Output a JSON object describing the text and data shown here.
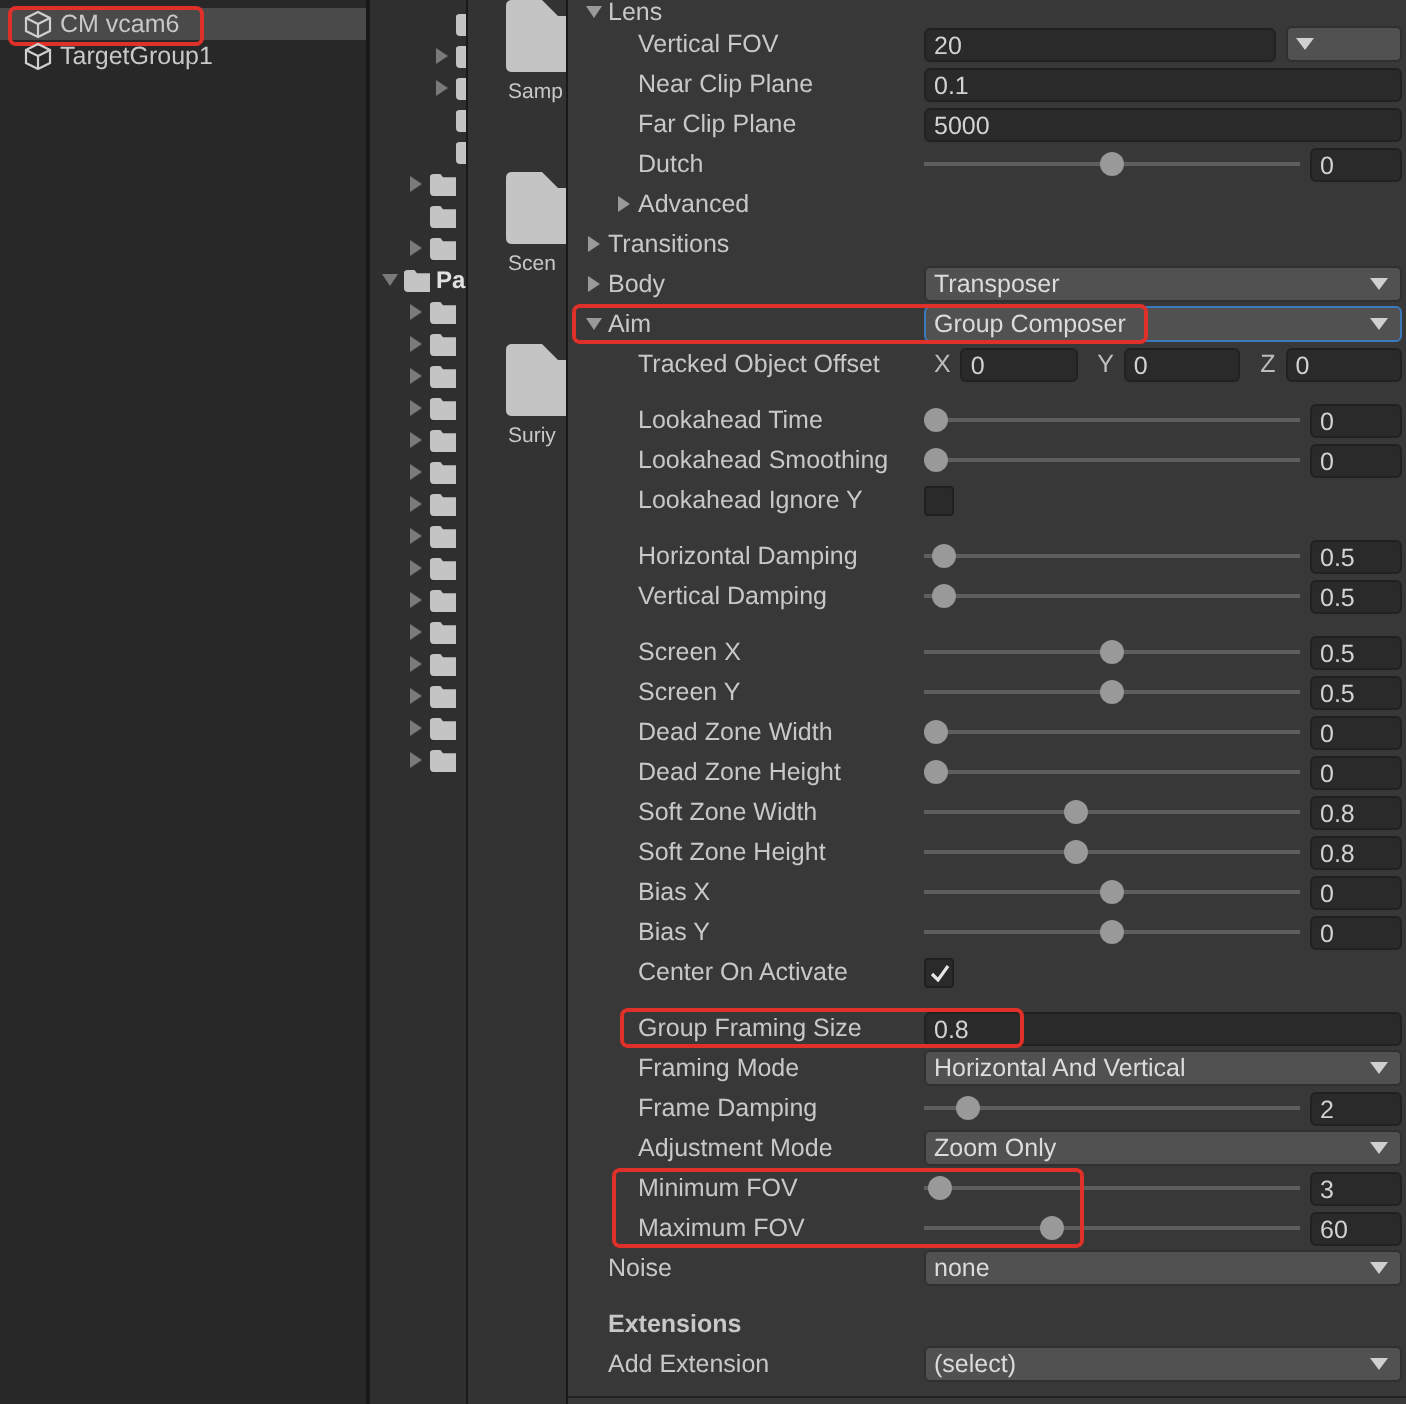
{
  "hierarchy": {
    "items": [
      {
        "label": "CM vcam6",
        "selected": true,
        "highlighted": true
      },
      {
        "label": "TargetGroup1",
        "selected": false,
        "highlighted": false
      }
    ]
  },
  "project_tree": {
    "top_items": [
      {
        "arrow": false
      },
      {
        "arrow": true,
        "expanded": false
      },
      {
        "arrow": true,
        "expanded": false
      },
      {
        "arrow": false
      },
      {
        "arrow": false
      }
    ],
    "upper_items": [
      {
        "arrow": true,
        "expanded": false
      },
      {
        "arrow": false
      },
      {
        "arrow": true,
        "expanded": false
      }
    ],
    "items": [
      {
        "arrow": true,
        "expanded": true,
        "label": "Pa",
        "children": [
          {
            "arrow": true,
            "expanded": false
          },
          {
            "arrow": true,
            "expanded": false
          },
          {
            "arrow": true,
            "expanded": false
          },
          {
            "arrow": true,
            "expanded": false
          },
          {
            "arrow": true,
            "expanded": false
          },
          {
            "arrow": true,
            "expanded": false
          },
          {
            "arrow": true,
            "expanded": false
          },
          {
            "arrow": true,
            "expanded": false
          },
          {
            "arrow": true,
            "expanded": false
          },
          {
            "arrow": true,
            "expanded": false
          },
          {
            "arrow": true,
            "expanded": false
          },
          {
            "arrow": true,
            "expanded": false
          },
          {
            "arrow": true,
            "expanded": false
          },
          {
            "arrow": true,
            "expanded": false
          },
          {
            "arrow": true,
            "expanded": false
          }
        ]
      }
    ]
  },
  "project_grid": {
    "items": [
      {
        "label": "Samp"
      },
      {
        "label": "Scen"
      },
      {
        "label": "Suriy"
      }
    ]
  },
  "inspector": {
    "sections": [
      {
        "kind": "foldout",
        "label": "Lens",
        "expanded": true,
        "children": [
          {
            "kind": "float_dropdown",
            "label": "Vertical FOV",
            "value": "20"
          },
          {
            "kind": "float",
            "label": "Near Clip Plane",
            "value": "0.1"
          },
          {
            "kind": "float",
            "label": "Far Clip Plane",
            "value": "5000"
          },
          {
            "kind": "slider",
            "label": "Dutch",
            "level": 0.5,
            "value": "0"
          },
          {
            "kind": "foldout",
            "label": "Advanced",
            "expanded": false
          }
        ]
      },
      {
        "kind": "foldout",
        "label": "Transitions",
        "expanded": false
      },
      {
        "kind": "foldout_dropdown",
        "label": "Body",
        "expanded": false,
        "value": "Transposer",
        "focused": false,
        "highlighted": false
      },
      {
        "kind": "foldout_dropdown",
        "label": "Aim",
        "expanded": true,
        "value": "Group Composer",
        "focused": true,
        "highlighted": true,
        "groups": [
          {
            "children": [
              {
                "kind": "vector",
                "label": "Tracked Object Offset",
                "components": [
                  {
                    "axis": "X",
                    "value": "0"
                  },
                  {
                    "axis": "Y",
                    "value": "0"
                  },
                  {
                    "axis": "Z",
                    "value": "0"
                  }
                ]
              }
            ]
          },
          {
            "children": [
              {
                "kind": "slider",
                "label": "Lookahead Time",
                "level": 0,
                "value": "0"
              },
              {
                "kind": "slider",
                "label": "Lookahead Smoothing",
                "level": 0,
                "value": "0"
              },
              {
                "kind": "checkbox",
                "label": "Lookahead Ignore Y",
                "checked": false
              }
            ]
          },
          {
            "children": [
              {
                "kind": "slider",
                "label": "Horizontal Damping",
                "level": 0.02,
                "value": "0.5"
              },
              {
                "kind": "slider",
                "label": "Vertical Damping",
                "level": 0.02,
                "value": "0.5"
              }
            ]
          },
          {
            "children": [
              {
                "kind": "slider",
                "label": "Screen X",
                "level": 0.5,
                "value": "0.5"
              },
              {
                "kind": "slider",
                "label": "Screen Y",
                "level": 0.5,
                "value": "0.5"
              },
              {
                "kind": "slider",
                "label": "Dead Zone Width",
                "level": 0,
                "value": "0"
              },
              {
                "kind": "slider",
                "label": "Dead Zone Height",
                "level": 0,
                "value": "0"
              },
              {
                "kind": "slider",
                "label": "Soft Zone Width",
                "level": 0.4,
                "value": "0.8"
              },
              {
                "kind": "slider",
                "label": "Soft Zone Height",
                "level": 0.4,
                "value": "0.8"
              },
              {
                "kind": "slider",
                "label": "Bias X",
                "level": 0.5,
                "value": "0"
              },
              {
                "kind": "slider",
                "label": "Bias Y",
                "level": 0.5,
                "value": "0"
              },
              {
                "kind": "checkbox",
                "label": "Center On Activate",
                "checked": true
              }
            ]
          },
          {
            "children": [
              {
                "kind": "float",
                "label": "Group Framing Size",
                "value": "0.8",
                "highlighted": true
              },
              {
                "kind": "dropdown",
                "label": "Framing Mode",
                "value": "Horizontal And Vertical"
              },
              {
                "kind": "slider",
                "label": "Frame Damping",
                "level": 0.09,
                "value": "2"
              },
              {
                "kind": "dropdown",
                "label": "Adjustment Mode",
                "value": "Zoom Only"
              },
              {
                "kind": "highlight_group",
                "children": [
                  {
                    "kind": "slider",
                    "label": "Minimum FOV",
                    "level": 0.01,
                    "value": "3"
                  },
                  {
                    "kind": "slider",
                    "label": "Maximum FOV",
                    "level": 0.33,
                    "value": "60"
                  }
                ]
              }
            ]
          }
        ]
      },
      {
        "kind": "dropdown",
        "label": "Noise",
        "value": "none"
      },
      {
        "kind": "header",
        "label": "Extensions"
      },
      {
        "kind": "dropdown",
        "label": "Add Extension",
        "value": "(select)"
      }
    ]
  }
}
